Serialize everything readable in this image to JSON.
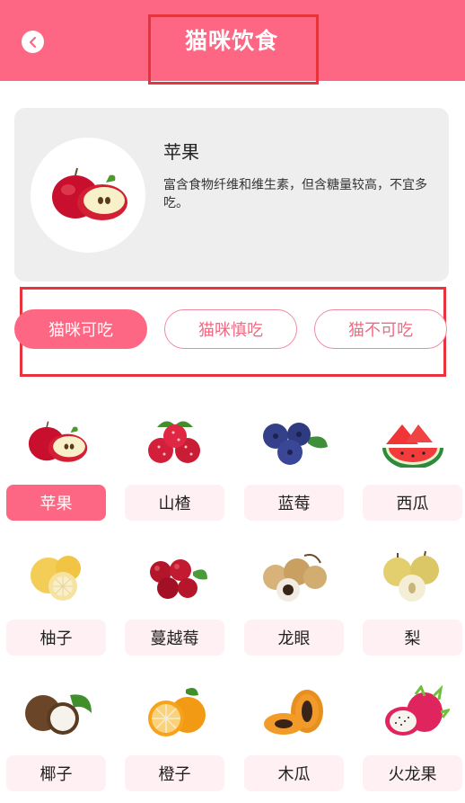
{
  "header": {
    "title": "猫咪饮食",
    "back_icon": "chevron-left-icon",
    "color": "#fe6783"
  },
  "detail": {
    "name": "苹果",
    "description": "富含食物纤维和维生素，但含糖量较高，不宜多吃。",
    "image_icon": "apple-icon"
  },
  "tabs": [
    {
      "label": "猫咪可吃",
      "active": true
    },
    {
      "label": "猫咪慎吃",
      "active": false
    },
    {
      "label": "猫不可吃",
      "active": false
    }
  ],
  "foods": [
    {
      "label": "苹果",
      "icon": "apple-icon",
      "selected": true
    },
    {
      "label": "山楂",
      "icon": "hawthorn-icon",
      "selected": false
    },
    {
      "label": "蓝莓",
      "icon": "blueberry-icon",
      "selected": false
    },
    {
      "label": "西瓜",
      "icon": "watermelon-icon",
      "selected": false
    },
    {
      "label": "柚子",
      "icon": "pomelo-icon",
      "selected": false
    },
    {
      "label": "蔓越莓",
      "icon": "cranberry-icon",
      "selected": false
    },
    {
      "label": "龙眼",
      "icon": "longan-icon",
      "selected": false
    },
    {
      "label": "梨",
      "icon": "pear-icon",
      "selected": false
    },
    {
      "label": "椰子",
      "icon": "coconut-icon",
      "selected": false
    },
    {
      "label": "橙子",
      "icon": "orange-icon",
      "selected": false
    },
    {
      "label": "木瓜",
      "icon": "papaya-icon",
      "selected": false
    },
    {
      "label": "火龙果",
      "icon": "dragon-fruit-icon",
      "selected": false
    }
  ]
}
